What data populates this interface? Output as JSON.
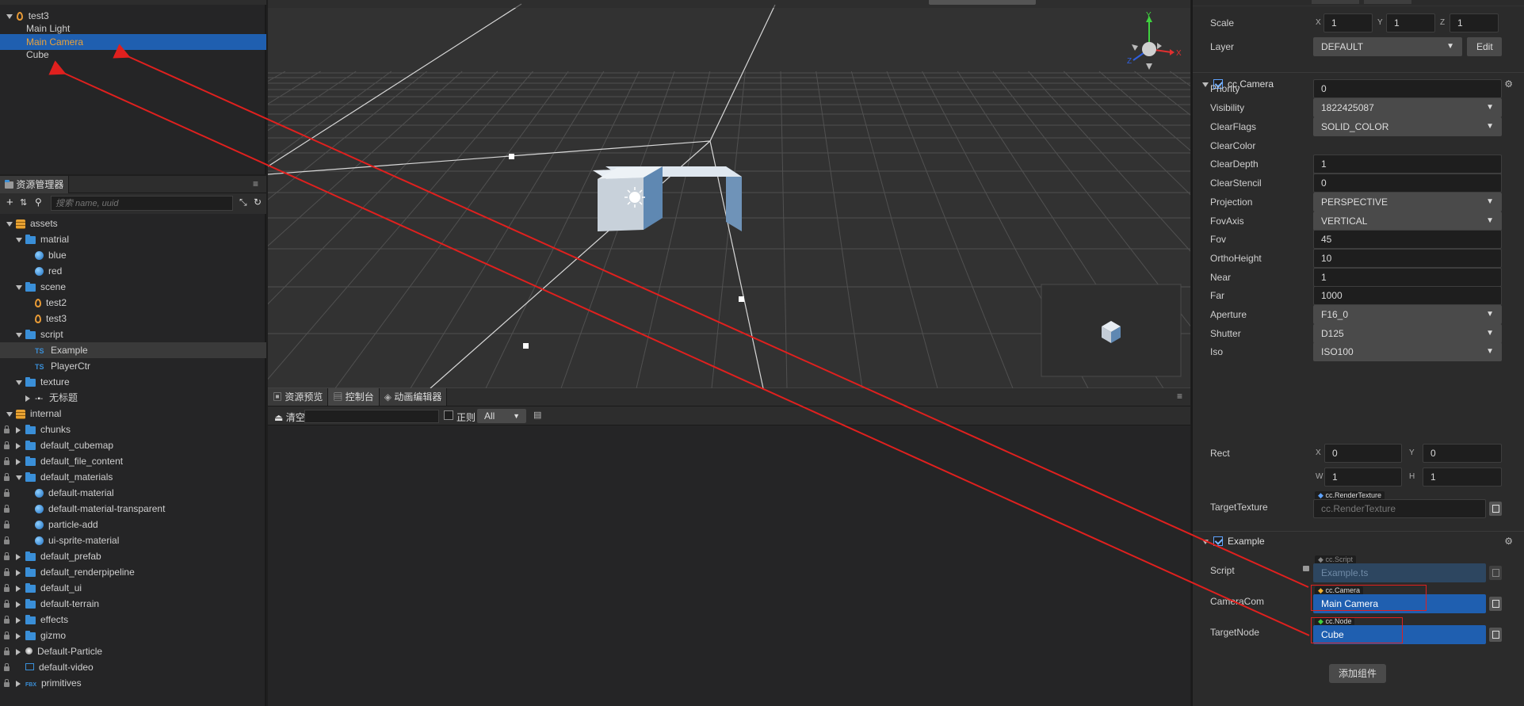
{
  "hierarchy": {
    "root": "test3",
    "items": [
      {
        "label": "Main Light"
      },
      {
        "label": "Main Camera"
      },
      {
        "label": "Cube"
      }
    ]
  },
  "assets": {
    "tab": "资源管理器",
    "search_placeholder": "搜索 name, uuid",
    "tree": [
      {
        "label": "assets"
      },
      {
        "label": "matrial"
      },
      {
        "label": "blue"
      },
      {
        "label": "red"
      },
      {
        "label": "scene"
      },
      {
        "label": "test2"
      },
      {
        "label": "test3"
      },
      {
        "label": "script"
      },
      {
        "label": "Example"
      },
      {
        "label": "PlayerCtr"
      },
      {
        "label": "texture"
      },
      {
        "label": "无标题"
      },
      {
        "label": "internal"
      },
      {
        "label": "chunks"
      },
      {
        "label": "default_cubemap"
      },
      {
        "label": "default_file_content"
      },
      {
        "label": "default_materials"
      },
      {
        "label": "default-material"
      },
      {
        "label": "default-material-transparent"
      },
      {
        "label": "particle-add"
      },
      {
        "label": "ui-sprite-material"
      },
      {
        "label": "default_prefab"
      },
      {
        "label": "default_renderpipeline"
      },
      {
        "label": "default_ui"
      },
      {
        "label": "default-terrain"
      },
      {
        "label": "effects"
      },
      {
        "label": "gizmo"
      },
      {
        "label": "Default-Particle"
      },
      {
        "label": "default-video"
      },
      {
        "label": "primitives"
      }
    ],
    "ts_label": "TS",
    "fbx_label": "FBX"
  },
  "console": {
    "tabs": [
      "资源预览",
      "控制台",
      "动画编辑器"
    ],
    "clear_label": "清空",
    "regex_label": "正则",
    "filter_value": "All"
  },
  "gizmo": {
    "x": "X",
    "y": "Y",
    "z": "Z"
  },
  "inspector": {
    "scale": {
      "label": "Scale",
      "x": "1",
      "y": "1",
      "z": "1",
      "ax": "X",
      "ay": "Y",
      "az": "Z"
    },
    "layer": {
      "label": "Layer",
      "value": "DEFAULT",
      "edit": "Edit"
    },
    "camera": {
      "title": "cc.Camera",
      "priority": {
        "label": "Priority",
        "value": "0"
      },
      "visibility": {
        "label": "Visibility",
        "value": "1822425087"
      },
      "clearFlags": {
        "label": "ClearFlags",
        "value": "SOLID_COLOR"
      },
      "clearColor": {
        "label": "ClearColor"
      },
      "clearDepth": {
        "label": "ClearDepth",
        "value": "1"
      },
      "clearStencil": {
        "label": "ClearStencil",
        "value": "0"
      },
      "projection": {
        "label": "Projection",
        "value": "PERSPECTIVE"
      },
      "fovAxis": {
        "label": "FovAxis",
        "value": "VERTICAL"
      },
      "fov": {
        "label": "Fov",
        "value": "45"
      },
      "orthoHeight": {
        "label": "OrthoHeight",
        "value": "10"
      },
      "near": {
        "label": "Near",
        "value": "1"
      },
      "far": {
        "label": "Far",
        "value": "1000"
      },
      "aperture": {
        "label": "Aperture",
        "value": "F16_0"
      },
      "shutter": {
        "label": "Shutter",
        "value": "D125"
      },
      "iso": {
        "label": "Iso",
        "value": "ISO100"
      },
      "rect": {
        "label": "Rect",
        "x": "0",
        "y": "0",
        "w": "1",
        "h": "1",
        "ax": "X",
        "ay": "Y",
        "aw": "W",
        "ah": "H"
      },
      "targetTexture": {
        "label": "TargetTexture",
        "tag": "cc.RenderTexture",
        "placeholder": "cc.RenderTexture"
      }
    },
    "example": {
      "title": "Example",
      "script": {
        "label": "Script",
        "tag": "cc.Script",
        "value": "Example.ts"
      },
      "cameraCom": {
        "label": "CameraCom",
        "tag": "cc.Camera",
        "value": "Main Camera"
      },
      "targetNode": {
        "label": "TargetNode",
        "tag": "cc.Node",
        "value": "Cube"
      }
    },
    "add_component": "添加组件"
  },
  "colors": {
    "accent": "#1f5fb0",
    "annotation": "#e0201e",
    "camera_label": "#e9a23b"
  }
}
